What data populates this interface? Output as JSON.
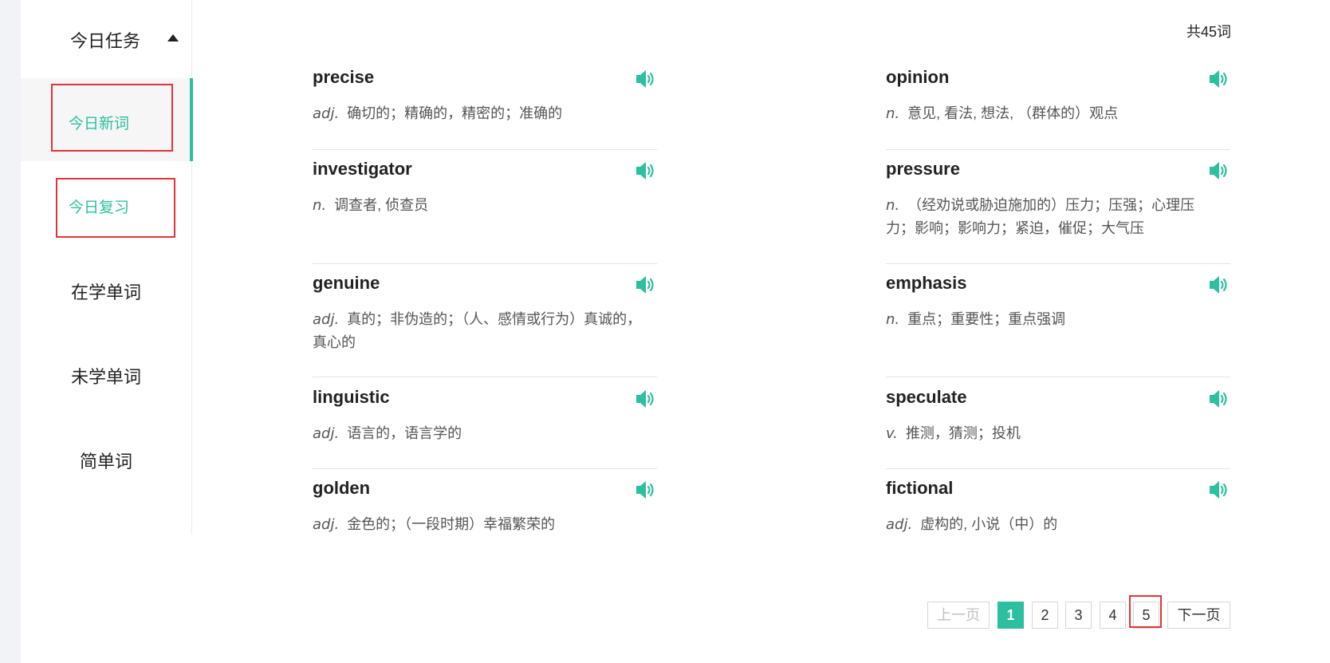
{
  "sidebar": {
    "header": "今日任务",
    "items": [
      {
        "label": "今日新词"
      },
      {
        "label": "今日复习"
      },
      {
        "label": "在学单词"
      },
      {
        "label": "未学单词"
      },
      {
        "label": "简单词"
      }
    ],
    "colors": {
      "accent": "#2cbfa0",
      "highlight_box": "#e0343a"
    }
  },
  "word_list": {
    "count_label": "共45词",
    "left": [
      {
        "word": "precise",
        "pos": "adj.",
        "meaning": "确切的；精确的，精密的；准确的"
      },
      {
        "word": "investigator",
        "pos": "n.",
        "meaning": "调查者, 侦查员"
      },
      {
        "word": "genuine",
        "pos": "adj.",
        "meaning": "真的；非伪造的；（人、感情或行为）真诚的，真心的"
      },
      {
        "word": "linguistic",
        "pos": "adj.",
        "meaning": "语言的，语言学的"
      },
      {
        "word": "golden",
        "pos": "adj.",
        "meaning": "金色的；（一段时期）幸福繁荣的"
      }
    ],
    "right": [
      {
        "word": "opinion",
        "pos": "n.",
        "meaning": "意见, 看法, 想法, （群体的）观点"
      },
      {
        "word": "pressure",
        "pos": "n.",
        "meaning": "（经劝说或胁迫施加的）压力；压强；心理压力；影响；影响力；紧迫，催促；大气压"
      },
      {
        "word": "emphasis",
        "pos": "n.",
        "meaning": "重点；重要性；重点强调"
      },
      {
        "word": "speculate",
        "pos": "v.",
        "meaning": "推测，猜测；投机"
      },
      {
        "word": "fictional",
        "pos": "adj.",
        "meaning": "虚构的, 小说（中）的"
      }
    ],
    "speaker_icon": "speaker-icon"
  },
  "pagination": {
    "prev_label": "上一页",
    "pages": [
      "1",
      "2",
      "3",
      "4",
      "5"
    ],
    "current_page": "1",
    "next_label": "下一页"
  }
}
